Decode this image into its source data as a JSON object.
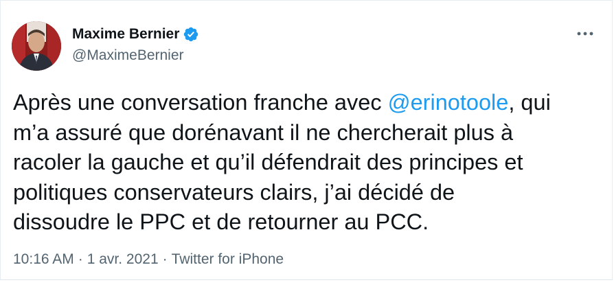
{
  "author": {
    "display_name": "Maxime Bernier",
    "handle": "@MaximeBernier",
    "verified": true
  },
  "icons": {
    "verified": "verified-badge-icon",
    "more": "more-options-icon"
  },
  "tweet": {
    "text_before": "Après une conversation franche avec ",
    "mention": "@erinotoole",
    "text_after": ", qui\nm’a assuré que dorénavant il ne chercherait plus à\nracoler la gauche et qu’il défendrait des principes et\npolitiques conservateurs clairs, j’ai décidé de\ndissoudre le PPC et de retourner au PCC."
  },
  "meta": {
    "time": "10:16 AM",
    "separator": "·",
    "date": "1 avr. 2021",
    "source": "Twitter for iPhone"
  },
  "colors": {
    "link": "#1d9bf0",
    "secondary_text": "#536471",
    "primary_text": "#0f1419",
    "verified_badge": "#1d9bf0"
  }
}
